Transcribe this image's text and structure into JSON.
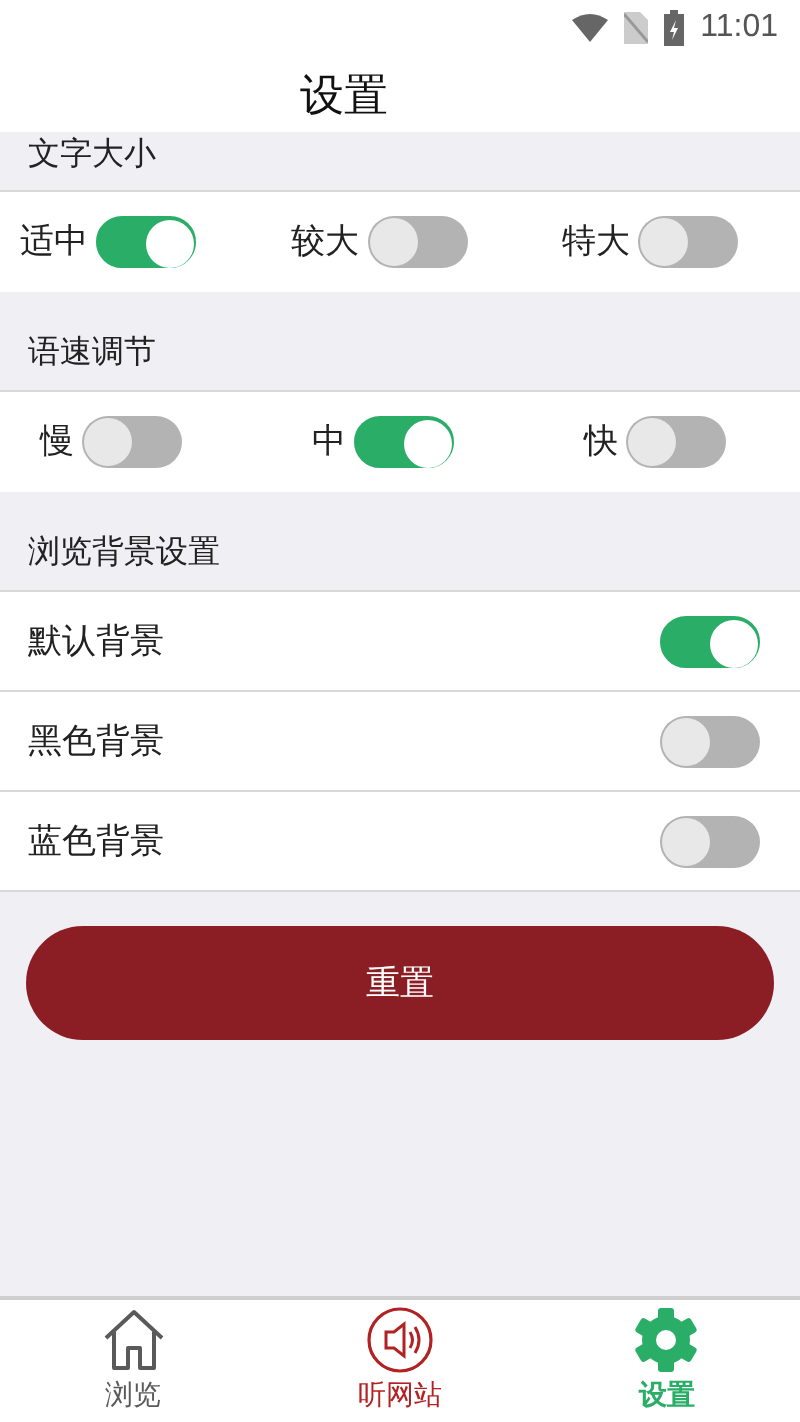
{
  "status_bar": {
    "time": "11:01"
  },
  "title": "设置",
  "font_size": {
    "header": "文字大小",
    "options": [
      {
        "label": "适中",
        "on": true
      },
      {
        "label": "较大",
        "on": false
      },
      {
        "label": "特大",
        "on": false
      }
    ]
  },
  "speech_rate": {
    "header": "语速调节",
    "options": [
      {
        "label": "慢",
        "on": false
      },
      {
        "label": "中",
        "on": true
      },
      {
        "label": "快",
        "on": false
      }
    ]
  },
  "background": {
    "header": "浏览背景设置",
    "options": [
      {
        "label": "默认背景",
        "on": true
      },
      {
        "label": "黑色背景",
        "on": false
      },
      {
        "label": "蓝色背景",
        "on": false
      }
    ]
  },
  "reset_button": "重置",
  "tabs": [
    {
      "label": "浏览",
      "kind": "home",
      "selected": false,
      "color": "#5a5a5a"
    },
    {
      "label": "听网站",
      "kind": "speaker",
      "selected": false,
      "color": "#b22222"
    },
    {
      "label": "设置",
      "kind": "gear",
      "selected": true,
      "color": "#2aae67"
    }
  ]
}
